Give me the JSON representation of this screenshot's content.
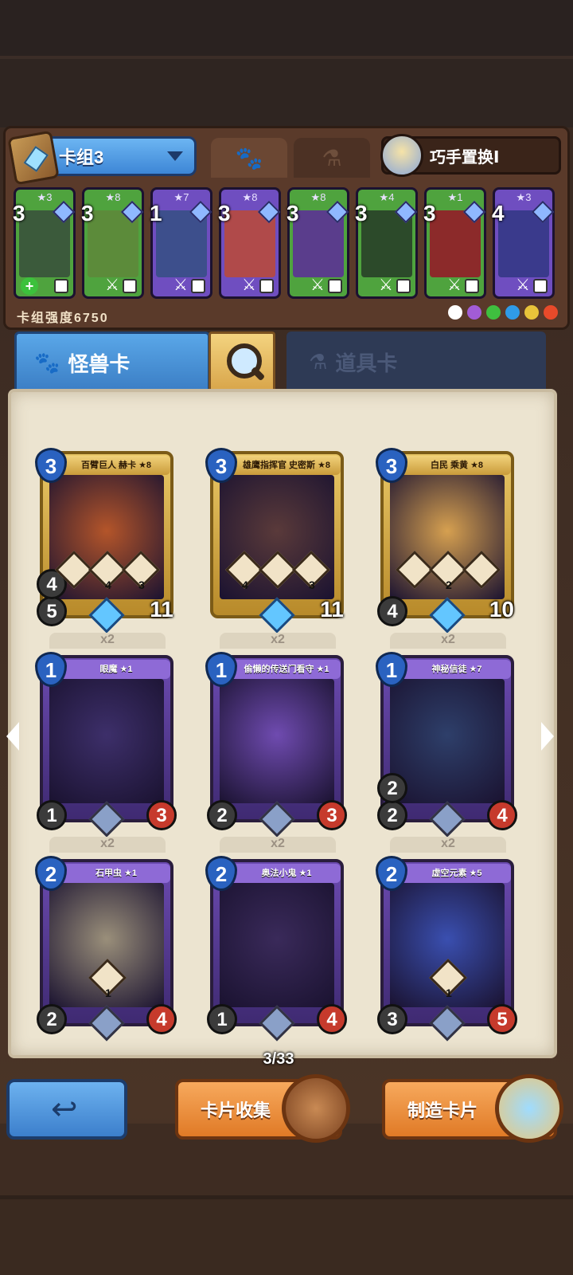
{
  "deck": {
    "name": "卡组3",
    "swap_label": "巧手置换Ⅰ",
    "power_label": "卡组强度6750",
    "cards": [
      {
        "cost": "3",
        "stars": "★3",
        "color": "#4fa33e",
        "art": "#3b5a3b",
        "has_plus": true
      },
      {
        "cost": "3",
        "stars": "★8",
        "color": "#4fa33e",
        "art": "#5c8b3a",
        "has_plus": false
      },
      {
        "cost": "1",
        "stars": "★7",
        "color": "#6f4ec0",
        "art": "#3d4f8c",
        "has_plus": false
      },
      {
        "cost": "3",
        "stars": "★8",
        "color": "#6f4ec0",
        "art": "#b04a4a",
        "has_plus": false
      },
      {
        "cost": "3",
        "stars": "★8",
        "color": "#4fa33e",
        "art": "#5a3d8c",
        "has_plus": false
      },
      {
        "cost": "3",
        "stars": "★4",
        "color": "#4fa33e",
        "art": "#2c4a2a",
        "has_plus": false
      },
      {
        "cost": "3",
        "stars": "★1",
        "color": "#4fa33e",
        "art": "#8c2a2a",
        "has_plus": false
      },
      {
        "cost": "4",
        "stars": "★3",
        "color": "#6f4ec0",
        "art": "#3a3a8c",
        "has_plus": false
      }
    ],
    "elements": [
      "#ffffff",
      "#a25cd6",
      "#3fbf3f",
      "#2f9be8",
      "#e8c33a",
      "#e84a2a"
    ]
  },
  "tabs": {
    "monster": "怪兽卡",
    "item": "道具卡"
  },
  "collection": {
    "cards": [
      {
        "name": "百臂巨人 赫卡 ★8",
        "cost": "3",
        "atk": "5",
        "def": "4",
        "hp": "11",
        "count": "",
        "gold": true,
        "art": "#b4552a",
        "skills": [
          "",
          "4",
          "3"
        ]
      },
      {
        "name": "雄鹰指挥官 史密斯 ★8",
        "cost": "3",
        "atk": "",
        "def": "",
        "hp": "11",
        "count": "",
        "gold": true,
        "art": "#5a3a3a",
        "skills": [
          "4",
          "",
          "3"
        ]
      },
      {
        "name": "白民 乘黄 ★8",
        "cost": "3",
        "atk": "4",
        "def": "",
        "hp": "10",
        "count": "",
        "gold": true,
        "art": "#d6a050",
        "skills": [
          "",
          "2",
          ""
        ]
      },
      {
        "name": "眼魔 ★1",
        "cost": "1",
        "atk": "1",
        "def": "",
        "hp": "3",
        "count": "x2",
        "gold": false,
        "art": "#3d2f6a",
        "skills": []
      },
      {
        "name": "偷懒的传送门看守 ★1",
        "cost": "1",
        "atk": "2",
        "def": "",
        "hp": "3",
        "count": "x2",
        "gold": false,
        "art": "#6f4bb0",
        "skills": []
      },
      {
        "name": "神秘信徒 ★7",
        "cost": "1",
        "atk": "2",
        "def": "2",
        "hp": "4",
        "count": "x2",
        "gold": false,
        "art": "#2e3f6a",
        "skills": []
      },
      {
        "name": "石甲虫 ★1",
        "cost": "2",
        "atk": "2",
        "def": "",
        "hp": "4",
        "count": "x2",
        "gold": false,
        "art": "#9a8f7a",
        "skills": [
          "1"
        ]
      },
      {
        "name": "奥法小鬼 ★1",
        "cost": "2",
        "atk": "1",
        "def": "",
        "hp": "4",
        "count": "x2",
        "gold": false,
        "art": "#3a2a5a",
        "skills": []
      },
      {
        "name": "虚空元素 ★5",
        "cost": "2",
        "atk": "3",
        "def": "",
        "hp": "5",
        "count": "x2",
        "gold": false,
        "art": "#3a4fb0",
        "skills": [
          "1"
        ]
      }
    ],
    "page": "3/33"
  },
  "buttons": {
    "collect": "卡片收集",
    "craft": "制造卡片"
  }
}
